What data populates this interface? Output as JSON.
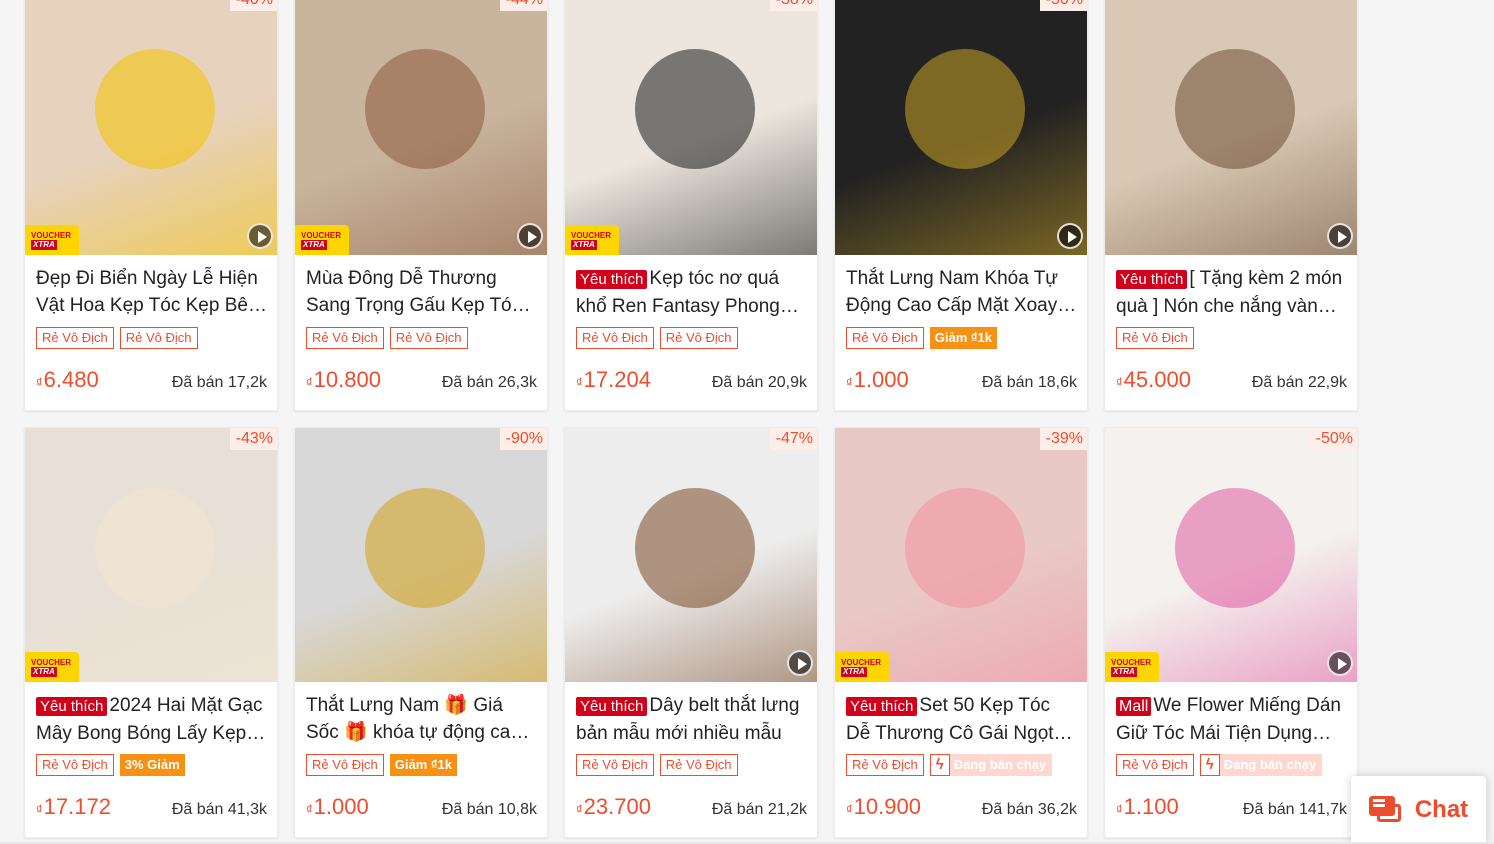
{
  "products": [
    {
      "title": "Đẹp Đi Biển Ngày Lễ Hiện Vật Hoa Kẹp Tóc Kẹp Bên Cạnh",
      "like": "",
      "mall": "",
      "discount": "-40%",
      "voucher": true,
      "play": true,
      "badges": [
        "Rẻ Vô Địch",
        "Rẻ Vô Địch"
      ],
      "orange": "",
      "hot": "",
      "currency": "₫",
      "price": "6.480",
      "sold": "Đã bán 17,2k",
      "img": "#e7d2bd",
      "accent": "#f4c300"
    },
    {
      "title": "Mùa Đông Dễ Thương Sang Trọng Gấu Kẹp Tóc Bông",
      "like": "",
      "mall": "",
      "discount": "-44%",
      "voucher": true,
      "play": true,
      "badges": [
        "Rẻ Vô Địch",
        "Rẻ Vô Địch"
      ],
      "orange": "",
      "hot": "",
      "currency": "₫",
      "price": "10.800",
      "sold": "Đã bán 26,3k",
      "img": "#c9b49e",
      "accent": "#8b5a3c"
    },
    {
      "title": "Kẹp tóc nơ quá khổ Ren Fantasy Phong Cách",
      "like": "Yêu thích",
      "mall": "",
      "discount": "-38%",
      "voucher": true,
      "play": false,
      "badges": [
        "Rẻ Vô Địch",
        "Rẻ Vô Địch"
      ],
      "orange": "",
      "hot": "",
      "currency": "₫",
      "price": "17.204",
      "sold": "Đã bán 20,9k",
      "img": "#ece6de",
      "accent": "#1a1a1a"
    },
    {
      "title": "Thắt Lưng Nam Khóa Tự Động Cao Cấp Mặt Xoay Thời Trang",
      "like": "",
      "mall": "",
      "discount": "-50%",
      "voucher": false,
      "play": true,
      "badges": [
        "Rẻ Vô Địch"
      ],
      "orange": "Giảm ₫1k",
      "hot": "",
      "currency": "₫",
      "price": "1.000",
      "sold": "Đã bán 18,6k",
      "img": "#222222",
      "accent": "#c9a227"
    },
    {
      "title": "[ Tặng kèm 2 món quà ] Nón che nắng vành rộng",
      "like": "Yêu thích",
      "mall": "",
      "discount": "",
      "voucher": false,
      "play": true,
      "badges": [
        "Rẻ Vô Địch"
      ],
      "orange": "",
      "hot": "",
      "currency": "₫",
      "price": "45.000",
      "sold": "Đã bán 22,9k",
      "img": "#d9c9b4",
      "accent": "#6b4a35"
    },
    {
      "title": "2024 Hai Mặt Gạc Mây Bong Bóng Lấy Kẹp Tóc",
      "like": "Yêu thích",
      "mall": "",
      "discount": "-43%",
      "voucher": true,
      "play": false,
      "badges": [
        "Rẻ Vô Địch"
      ],
      "orange": "3% Giảm",
      "hot": "",
      "currency": "₫",
      "price": "17.172",
      "sold": "Đã bán 41,3k",
      "img": "#e8e0d6",
      "accent": "#f3e6cf"
    },
    {
      "title": "Thắt Lưng Nam 🎁 Giá Sốc 🎁 khóa tự động cao cấp",
      "like": "",
      "mall": "",
      "discount": "-90%",
      "voucher": false,
      "play": false,
      "badges": [
        "Rẻ Vô Địch"
      ],
      "orange": "Giảm ₫1k",
      "hot": "",
      "currency": "₫",
      "price": "1.000",
      "sold": "Đã bán 10,8k",
      "img": "#d8d8d8",
      "accent": "#d4a017"
    },
    {
      "title": "Dây belt thắt lưng bản mẫu mới nhiều mẫu",
      "like": "Yêu thích",
      "mall": "",
      "discount": "-47%",
      "voucher": false,
      "play": true,
      "badges": [
        "Rẻ Vô Địch",
        "Rẻ Vô Địch"
      ],
      "orange": "",
      "hot": "",
      "currency": "₫",
      "price": "23.700",
      "sold": "Đã bán 21,2k",
      "img": "#ededed",
      "accent": "#7a4a26"
    },
    {
      "title": "Set 50 Kẹp Tóc Dễ Thương Cô Gái Ngọt Ngào",
      "like": "Yêu thích",
      "mall": "",
      "discount": "-39%",
      "voucher": true,
      "play": false,
      "badges": [
        "Rẻ Vô Địch"
      ],
      "orange": "",
      "hot": "Đang bán chạy",
      "currency": "₫",
      "price": "10.900",
      "sold": "Đã bán 36,2k",
      "img": "#e9c9c6",
      "accent": "#f08fa0"
    },
    {
      "title": "We Flower Miếng Dán Giữ Tóc Mái Tiện Dụng Không Dấu",
      "like": "",
      "mall": "Mall",
      "discount": "-50%",
      "voucher": true,
      "play": true,
      "badges": [
        "Rẻ Vô Địch"
      ],
      "orange": "",
      "hot": "Đang bán chạy",
      "currency": "₫",
      "price": "1.100",
      "sold": "Đã bán 141,7k",
      "img": "#f4f1ee",
      "accent": "#e05aa0"
    }
  ],
  "voucher": {
    "line1": "VOUCHER",
    "line2": "XTRA"
  },
  "chat": {
    "label": "Chat"
  }
}
